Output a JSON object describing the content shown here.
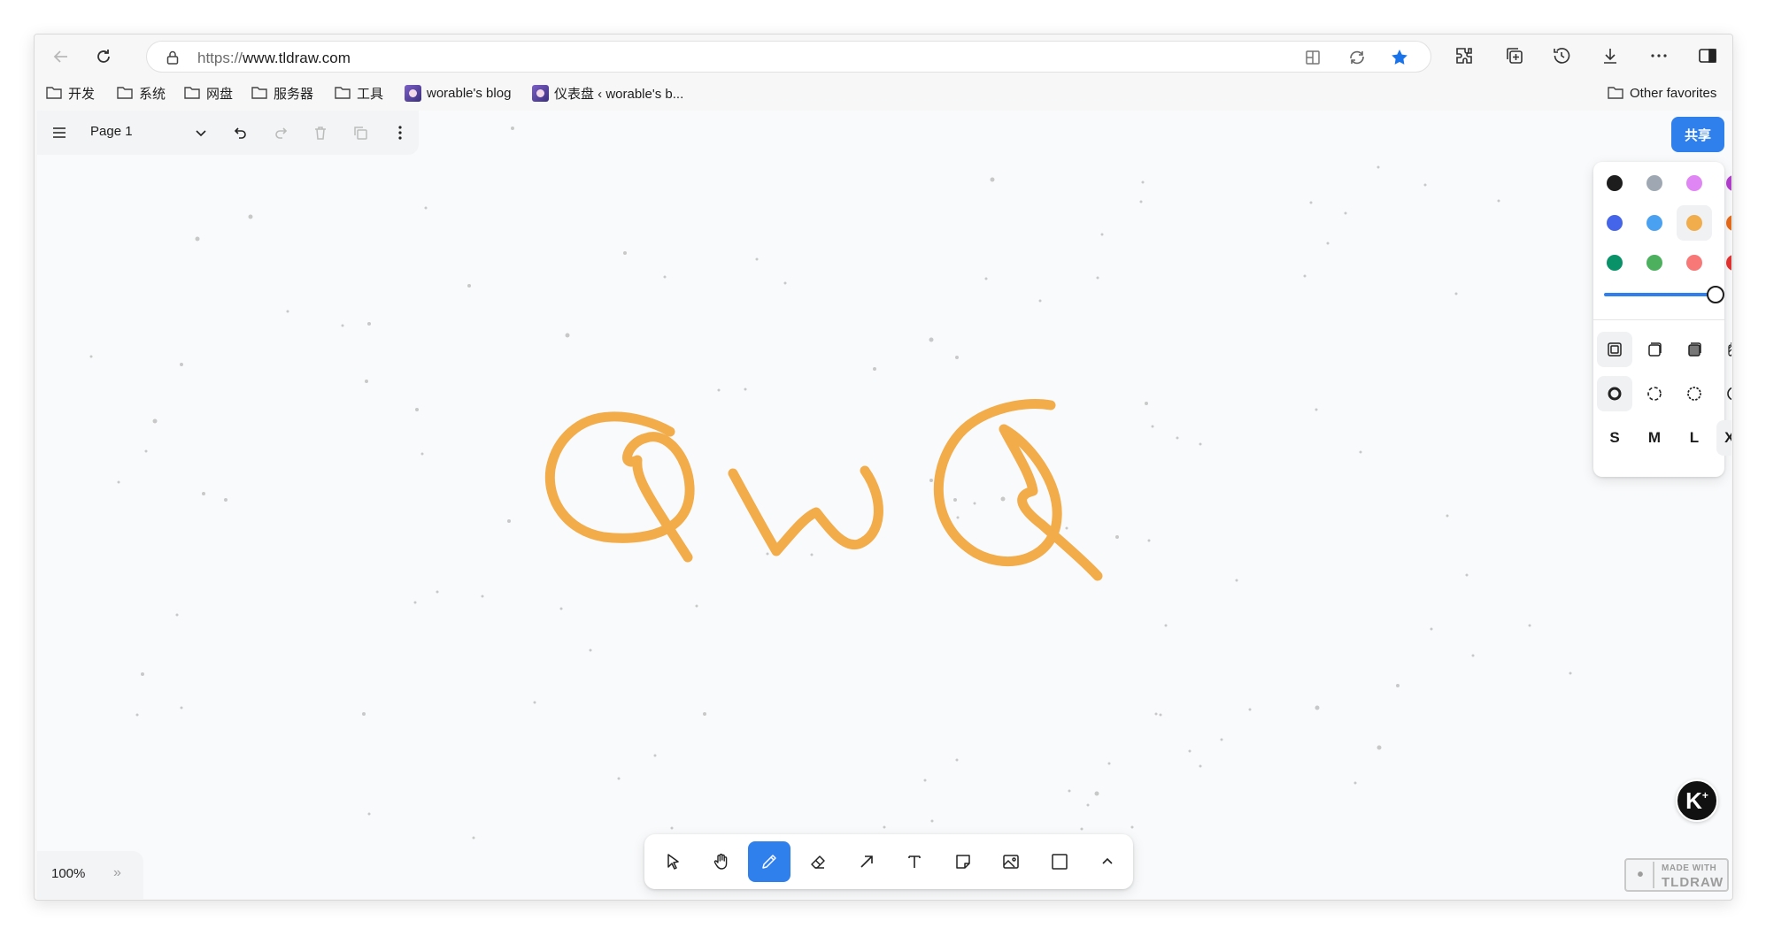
{
  "browser": {
    "url_scheme": "https://",
    "url_host": "www.tldraw.com",
    "nav_icons": [
      "back-icon",
      "refresh-icon"
    ],
    "omnibox_icons": [
      "lock-icon",
      "reading-view-icon",
      "edge-sync-icon",
      "favorite-star-icon"
    ],
    "toolbar_icons": [
      "extensions-icon",
      "collections-icon",
      "history-icon",
      "downloads-icon",
      "more-icon",
      "sidebar-icon"
    ],
    "accent": "#1a73e8"
  },
  "bookmarks": {
    "items": [
      {
        "label": "开发",
        "icon": "folder-icon"
      },
      {
        "label": "系统",
        "icon": "folder-icon"
      },
      {
        "label": "网盘",
        "icon": "folder-icon"
      },
      {
        "label": "服务器",
        "icon": "folder-icon"
      },
      {
        "label": "工具",
        "icon": "folder-icon"
      },
      {
        "label": "worable's blog",
        "icon": "site-favicon"
      },
      {
        "label": "仪表盘 ‹ worable's b...",
        "icon": "site-favicon"
      }
    ],
    "other": "Other favorites"
  },
  "app": {
    "page_name": "Page 1",
    "share_label": "共享",
    "zoom": "100%",
    "zoom_more": "»",
    "made_with_line1": "MADE WITH",
    "made_with_line2": "TLDRAW",
    "help_label": "K"
  },
  "drawing": {
    "text_shapes": "QwQ",
    "stroke_color": "#f2ac4a"
  },
  "style_panel": {
    "colors": [
      "#1d1d1d",
      "#9fa8b2",
      "#e085f4",
      "#ae3ec9",
      "#4465e9",
      "#4ba1f1",
      "#f1ac4b",
      "#e16919",
      "#099268",
      "#4cb05e",
      "#f87777",
      "#e03131"
    ],
    "selected_color_index": 6,
    "opacity": 1.0,
    "fill_options": [
      "fill-none-icon",
      "fill-semi-icon",
      "fill-solid-icon",
      "fill-pattern-icon"
    ],
    "dash_options": [
      "dash-draw-icon",
      "dash-dashed-icon",
      "dash-dotted-icon",
      "dash-solid-icon"
    ],
    "sizes": [
      "S",
      "M",
      "L",
      "XL"
    ],
    "selected_size": "XL"
  },
  "tools": [
    {
      "name": "select-tool",
      "icon": "cursor-icon"
    },
    {
      "name": "hand-tool",
      "icon": "hand-icon"
    },
    {
      "name": "draw-tool",
      "icon": "pencil-icon",
      "active": true
    },
    {
      "name": "eraser-tool",
      "icon": "eraser-icon"
    },
    {
      "name": "arrow-tool",
      "icon": "arrow-icon"
    },
    {
      "name": "text-tool",
      "icon": "text-icon"
    },
    {
      "name": "note-tool",
      "icon": "note-icon"
    },
    {
      "name": "image-tool",
      "icon": "image-icon"
    },
    {
      "name": "rectangle-tool",
      "icon": "rectangle-icon"
    },
    {
      "name": "more-tools",
      "icon": "chevron-up-icon"
    }
  ]
}
